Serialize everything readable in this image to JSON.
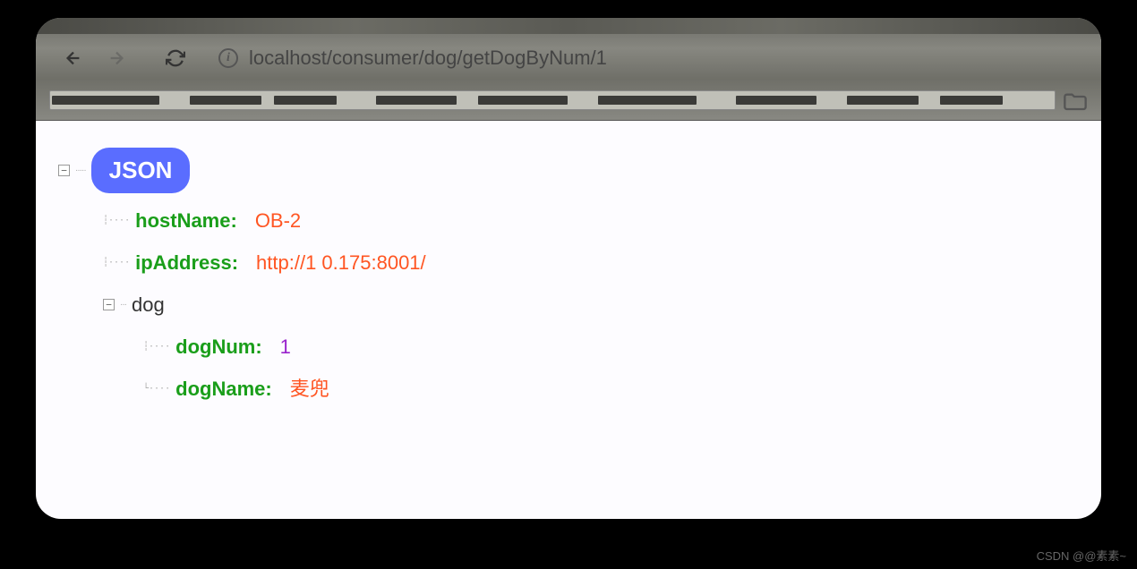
{
  "browser": {
    "url": "localhost/consumer/dog/getDogByNum/1"
  },
  "json_response": {
    "root_label": "JSON",
    "hostName": {
      "key": "hostName",
      "value": "OB-2"
    },
    "ipAddress": {
      "key": "ipAddress",
      "value": "http://1             0.175:8001/"
    },
    "dog": {
      "label": "dog",
      "dogNum": {
        "key": "dogNum",
        "value": "1"
      },
      "dogName": {
        "key": "dogName",
        "value": "麦兜"
      }
    }
  },
  "watermark": "CSDN @@素素~"
}
